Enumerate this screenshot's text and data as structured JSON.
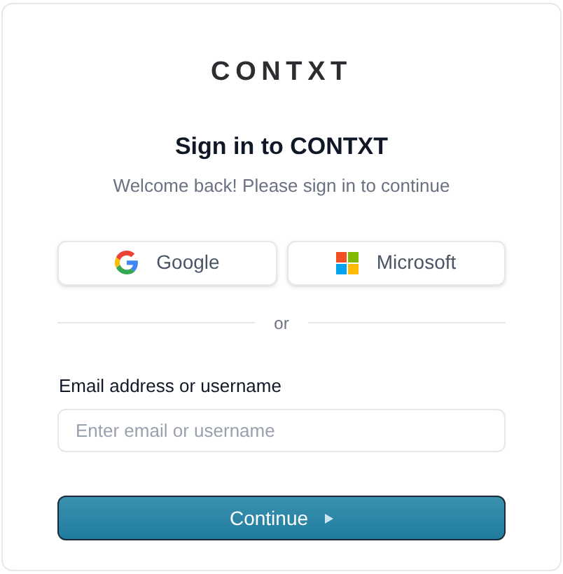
{
  "logo": "CONTXT",
  "title": "Sign in to CONTXT",
  "subtitle": "Welcome back! Please sign in to continue",
  "social_buttons": [
    {
      "kind": "google",
      "label": "Google"
    },
    {
      "kind": "microsoft",
      "label": "Microsoft"
    }
  ],
  "divider": "or",
  "email": {
    "label": "Email address or username",
    "placeholder": "Enter email or username"
  },
  "continue_button": "Continue"
}
